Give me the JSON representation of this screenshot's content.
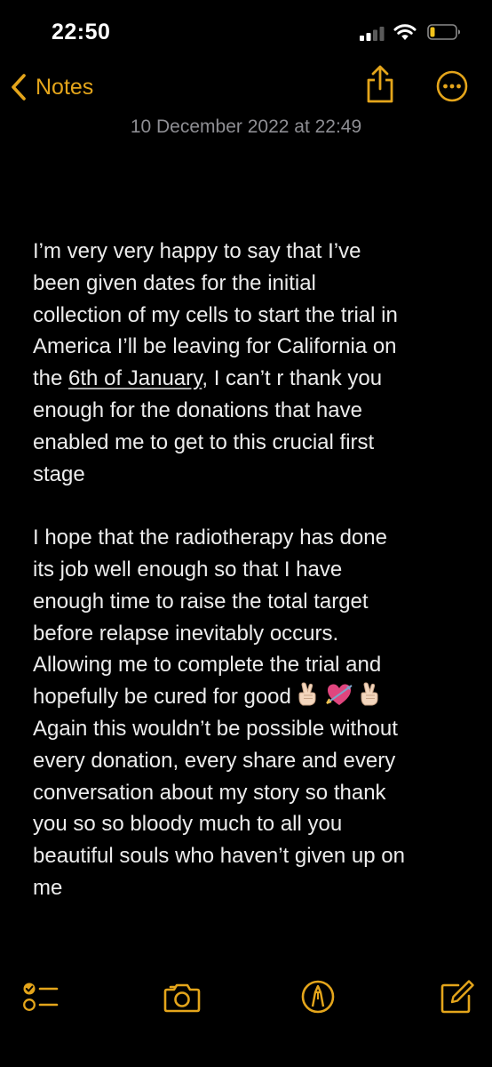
{
  "status_bar": {
    "time": "22:50"
  },
  "nav": {
    "back_label": "Notes"
  },
  "note": {
    "timestamp": "10 December 2022 at 22:49",
    "lines": [
      "I’m very very happy to say that I’ve",
      "been given dates for the initial",
      "collection of my cells to start the trial in",
      "America I’ll be leaving for California on"
    ],
    "line5_prefix": "the ",
    "line5_link": "6th of January",
    "line5_suffix": ", I can’t r thank you",
    "lines_b": [
      "enough for the donations that have",
      "enabled me to get to this crucial first",
      "stage"
    ],
    "lines_c": [
      "I hope that the radiotherapy has done",
      "its job well enough so that I have",
      "enough time to raise the total target",
      "before relapse inevitably occurs.",
      "Allowing me to complete the trial and"
    ],
    "line_emoji_text": "hopefully be cured for good",
    "emojis": [
      "crossed-fingers",
      "heart-with-arrow",
      "crossed-fingers"
    ],
    "lines_d": [
      "Again this wouldn’t be possible without",
      "every donation, every share and every",
      "conversation about my story so thank",
      "you so so bloody much to all you",
      "beautiful souls who haven’t given up on",
      "me"
    ]
  },
  "colors": {
    "accent": "#e4a51b",
    "background": "#000000",
    "text": "#ececec",
    "timestamp": "#8e8e93"
  },
  "icons": {
    "toolbar": [
      "checklist-icon",
      "camera-icon",
      "markup-pen-icon",
      "compose-icon"
    ]
  }
}
